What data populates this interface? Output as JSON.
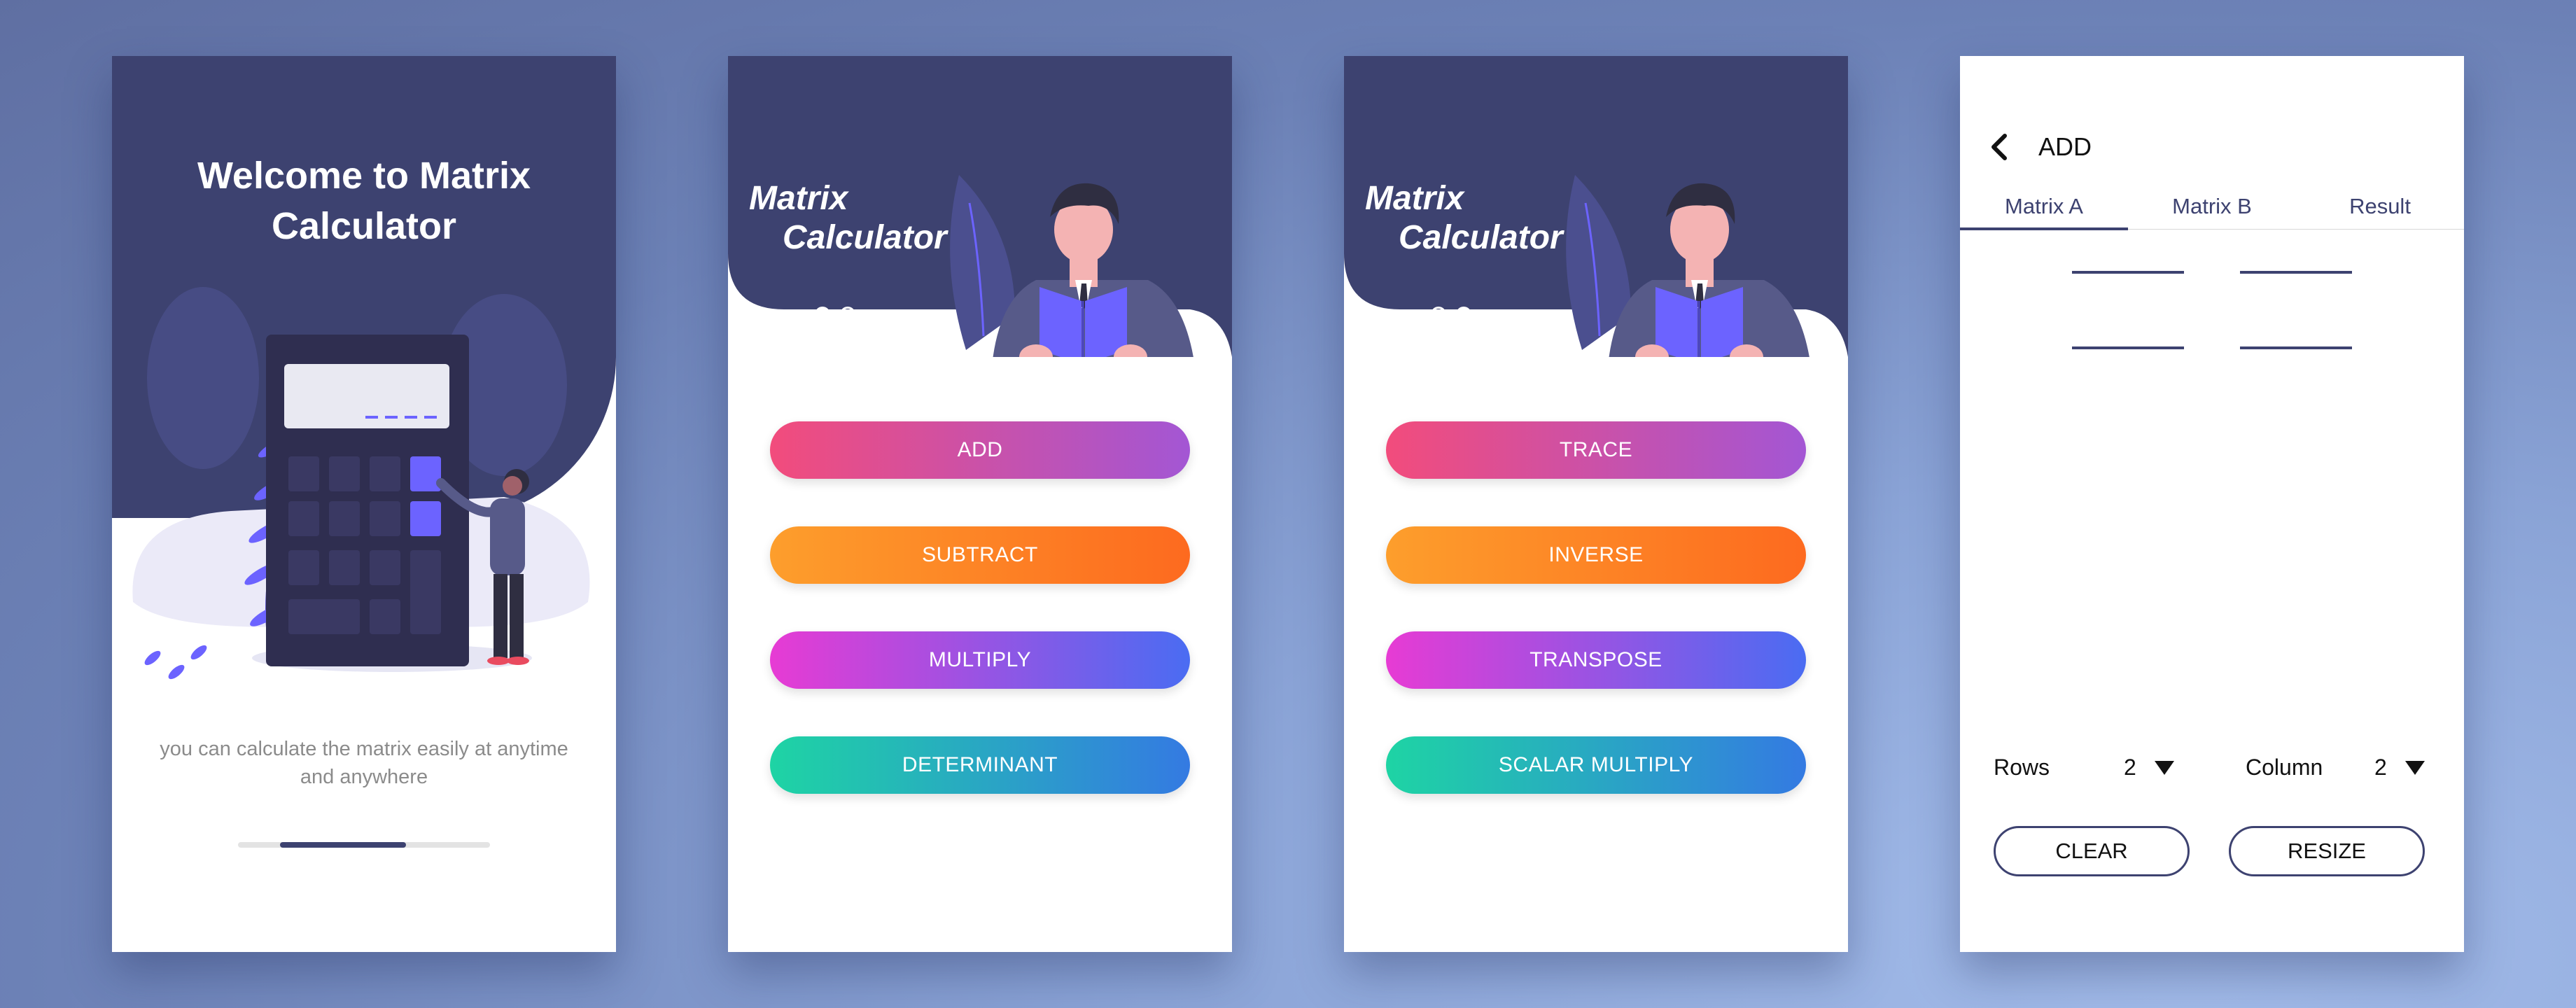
{
  "colors": {
    "navy": "#3d4270",
    "accent": "#6c5ce7",
    "background": "#8aa3d6"
  },
  "welcome": {
    "title": "Welcome to Matrix Calculator",
    "description": "you can calculate the matrix easily at anytime and anywhere",
    "progress": 0.5
  },
  "menu1": {
    "brand_line1": "Matrix",
    "brand_line2": "Calculator",
    "active_page": 1,
    "buttons": [
      {
        "label": "ADD",
        "style": "pink-purple"
      },
      {
        "label": "SUBTRACT",
        "style": "orange"
      },
      {
        "label": "MULTIPLY",
        "style": "magenta-blue"
      },
      {
        "label": "DETERMINANT",
        "style": "teal-blue"
      }
    ]
  },
  "menu2": {
    "brand_line1": "Matrix",
    "brand_line2": "Calculator",
    "active_page": 2,
    "buttons": [
      {
        "label": "TRACE",
        "style": "pink-purple"
      },
      {
        "label": "INVERSE",
        "style": "orange"
      },
      {
        "label": "TRANSPOSE",
        "style": "magenta-blue"
      },
      {
        "label": "SCALAR MULTIPLY",
        "style": "teal-blue"
      }
    ]
  },
  "add": {
    "title": "ADD",
    "back_icon": "chevron-left-icon",
    "tabs": [
      "Matrix A",
      "Matrix B",
      "Result"
    ],
    "active_tab": 0,
    "rows_label": "Rows",
    "rows_value": "2",
    "column_label": "Column",
    "column_value": "2",
    "clear_label": "CLEAR",
    "resize_label": "RESIZE"
  }
}
